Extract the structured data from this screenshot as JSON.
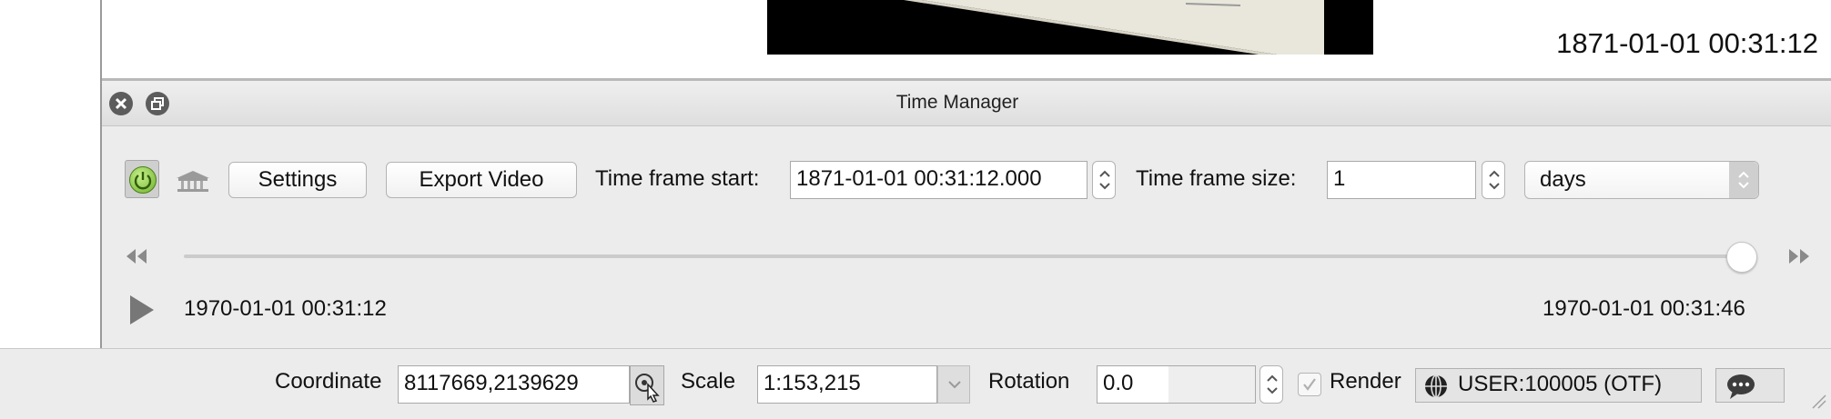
{
  "canvas": {
    "timestamp": "1871-01-01 00:31:12"
  },
  "dock": {
    "title": "Time Manager"
  },
  "toolbar": {
    "power_icon": "power-icon",
    "archive_icon": "archive-icon",
    "settings_label": "Settings",
    "export_video_label": "Export Video",
    "time_frame_start_label": "Time frame start:",
    "time_frame_start_value": "1871-01-01 00:31:12.000",
    "time_frame_size_label": "Time frame size:",
    "time_frame_size_value": "1",
    "unit_value": "days"
  },
  "timeline": {
    "start_time": "1970-01-01 00:31:12",
    "end_time": "1970-01-01 00:31:46",
    "slider_position_fraction": 1.0
  },
  "status_bar": {
    "coordinate_label": "Coordinate",
    "coordinate_value": "8117669,2139629",
    "scale_label": "Scale",
    "scale_value": "1:153,215",
    "rotation_label": "Rotation",
    "rotation_value": "0.0",
    "render_label": "Render",
    "render_checked": true,
    "crs_value": "USER:100005 (OTF)"
  },
  "colors": {
    "power_on": "#7bbf3a",
    "background": "#ececec"
  }
}
